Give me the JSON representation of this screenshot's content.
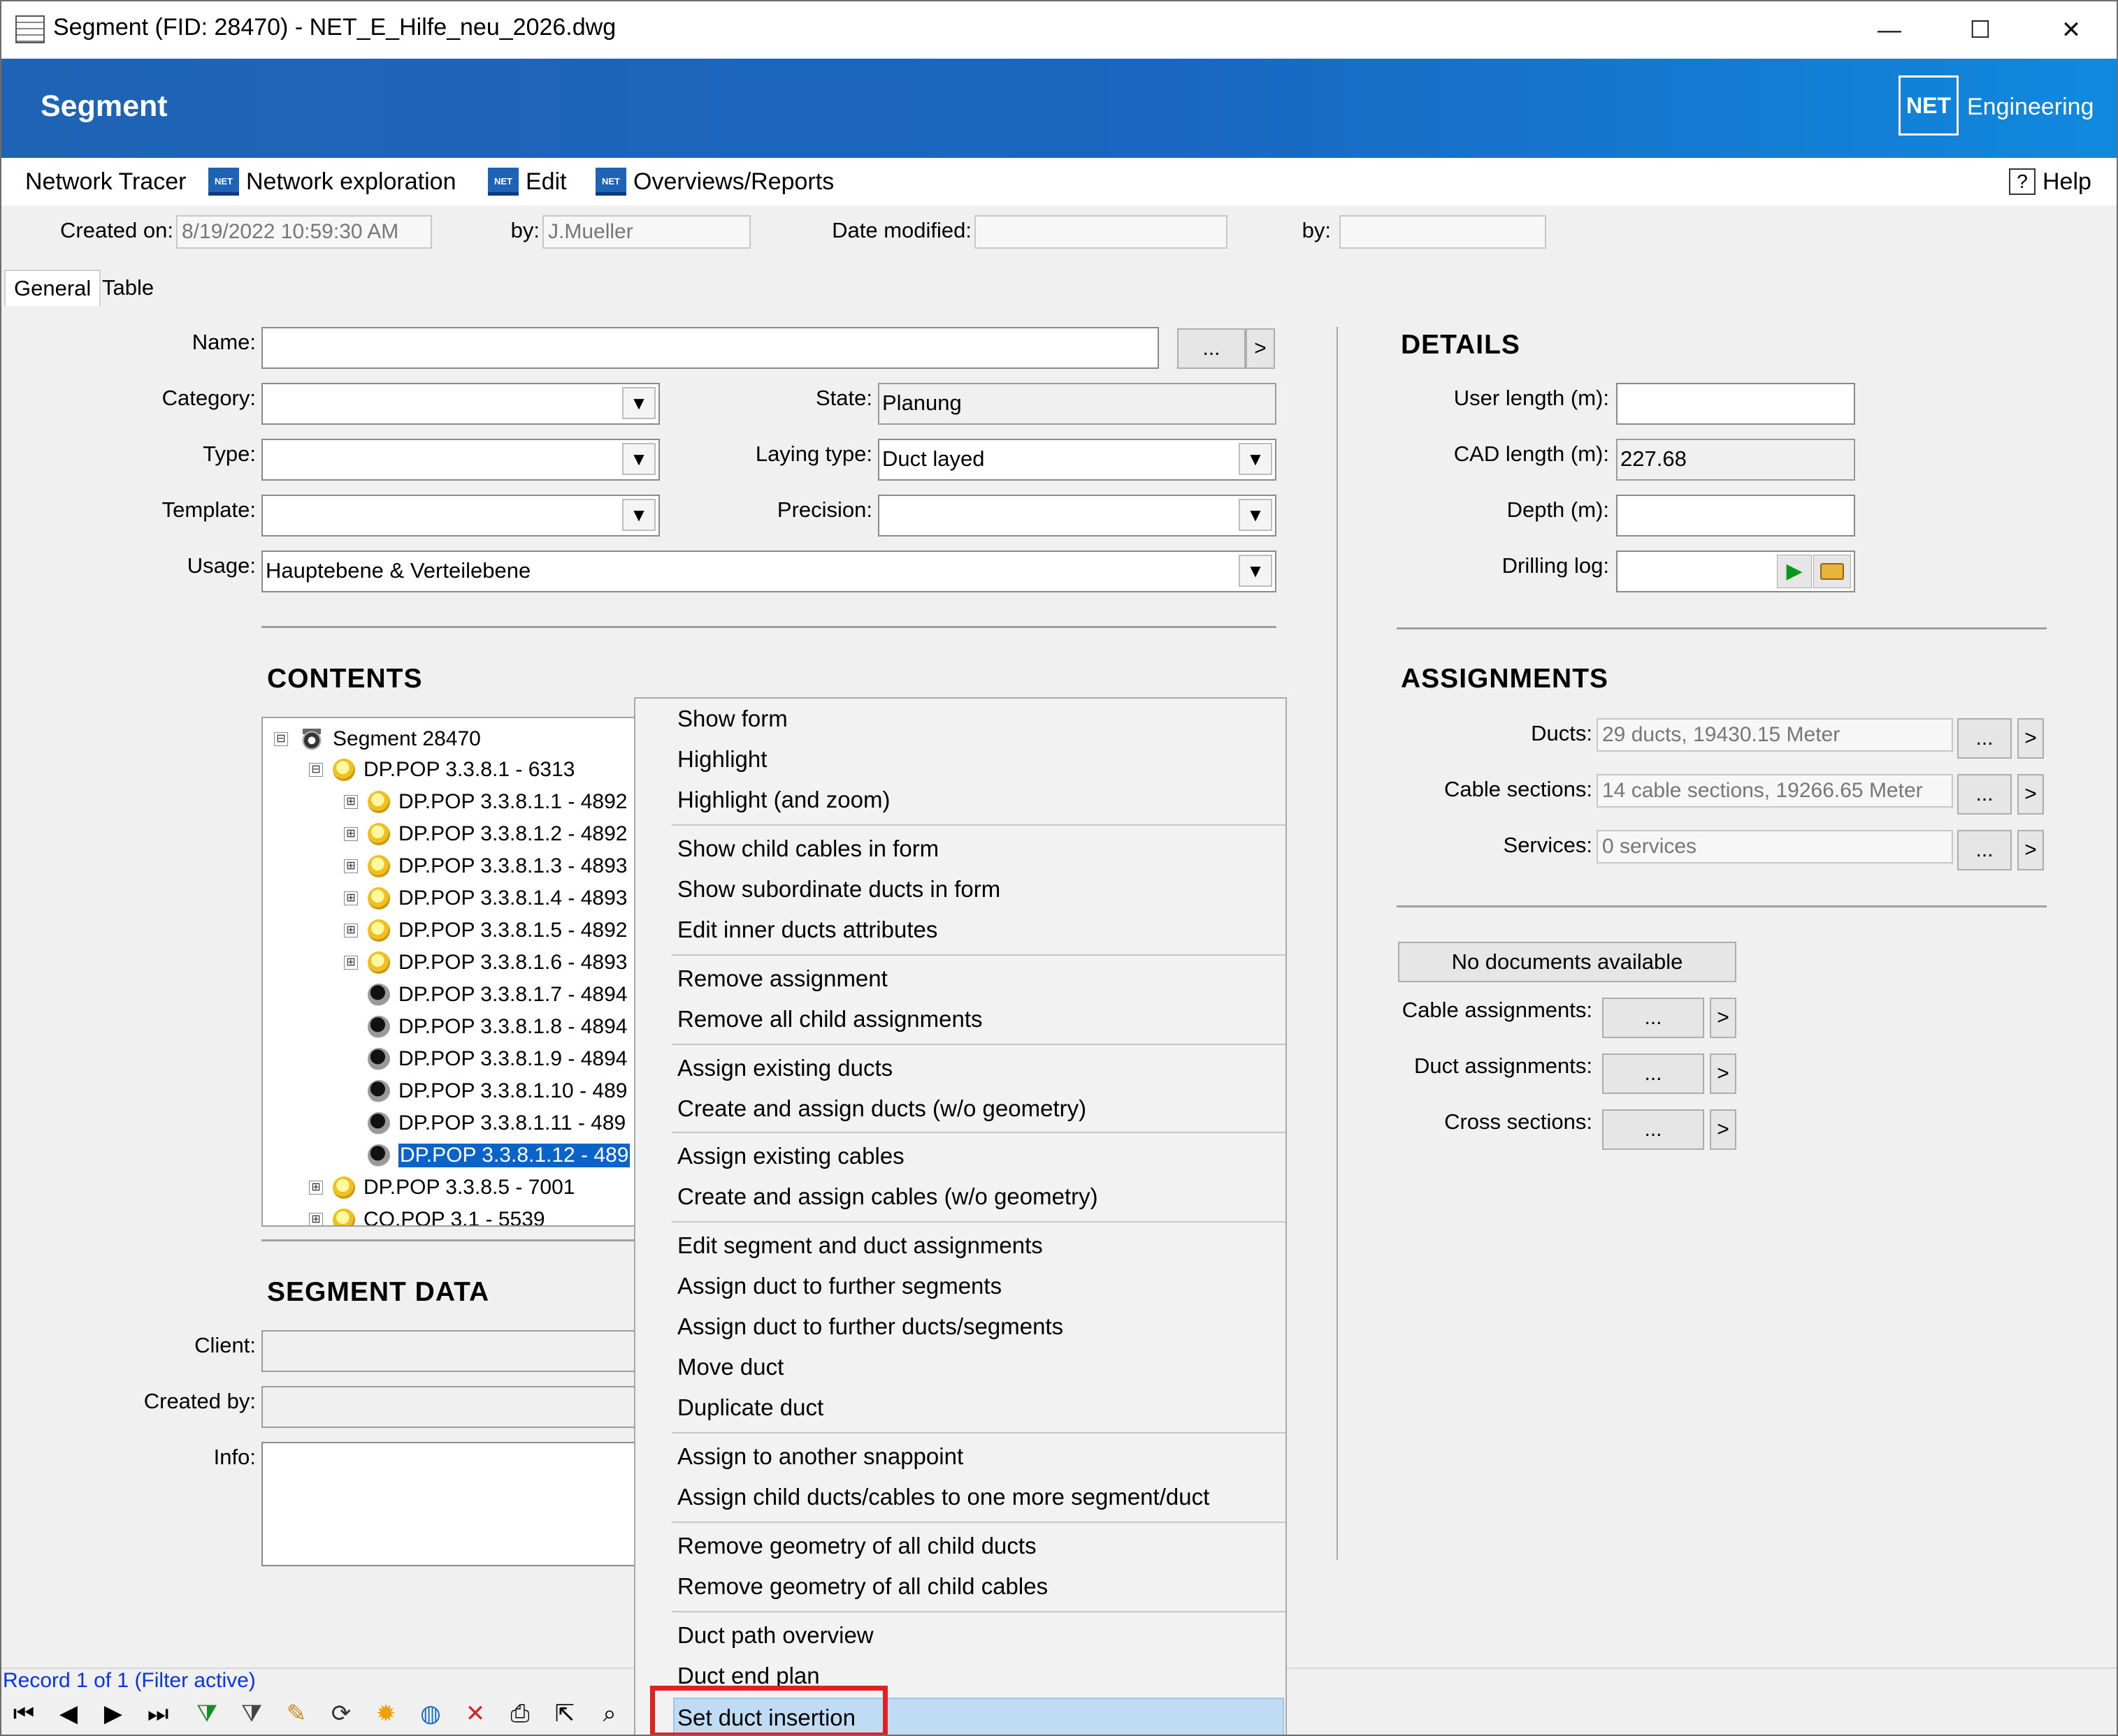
{
  "window": {
    "title": "Segment (FID: 28470) - NET_E_Hilfe_neu_2026.dwg",
    "minimize": "—",
    "maximize": "☐",
    "close": "✕"
  },
  "banner": {
    "title": "Segment",
    "logo": "NET",
    "brand": "Engineering",
    "color": "#1a66c0"
  },
  "menu": {
    "items": [
      "Network Tracer",
      "Network exploration",
      "Edit",
      "Overviews/Reports"
    ],
    "help": "Help",
    "net_icon": "NET"
  },
  "meta": {
    "created_on_label": "Created on:",
    "created_on_value": "8/19/2022 10:59:30 AM",
    "by_label": "by:",
    "by_value": "J.Mueller",
    "modified_label": "Date modified:",
    "modified_value": "",
    "by2_label": "by:",
    "by2_value": ""
  },
  "tabs": [
    "General",
    "Table"
  ],
  "general": {
    "name_label": "Name:",
    "name_value": "",
    "name_btn": "...",
    "name_arrow": ">",
    "category_label": "Category:",
    "type_label": "Type:",
    "template_label": "Template:",
    "usage_label": "Usage:",
    "usage_value": "Hauptebene & Verteilebene",
    "state_label": "State:",
    "state_value": "Planung",
    "laying_label": "Laying type:",
    "laying_value": "Duct layed",
    "precision_label": "Precision:",
    "dropdown_arrow": "▼"
  },
  "contents": {
    "heading": "CONTENTS",
    "tree": [
      {
        "label": "Segment 28470",
        "sign": "⊟",
        "icon": "segment-icon"
      },
      {
        "label": "DP.POP 3.3.8.1 - 6313",
        "sign": "⊟",
        "icon": "yellow"
      },
      {
        "label": "DP.POP 3.3.8.1.1 - 4892",
        "sign": "⊞",
        "icon": "yellow"
      },
      {
        "label": "DP.POP 3.3.8.1.2 - 4892",
        "sign": "⊞",
        "icon": "yellow"
      },
      {
        "label": "DP.POP 3.3.8.1.3 - 4893",
        "sign": "⊞",
        "icon": "yellow"
      },
      {
        "label": "DP.POP 3.3.8.1.4 - 4893",
        "sign": "⊞",
        "icon": "yellow"
      },
      {
        "label": "DP.POP 3.3.8.1.5 - 4892",
        "sign": "⊞",
        "icon": "yellow"
      },
      {
        "label": "DP.POP 3.3.8.1.6 - 4893",
        "sign": "⊞",
        "icon": "yellow"
      },
      {
        "label": "DP.POP 3.3.8.1.7 - 4894",
        "sign": "",
        "icon": "dark"
      },
      {
        "label": "DP.POP 3.3.8.1.8 - 4894",
        "sign": "",
        "icon": "dark"
      },
      {
        "label": "DP.POP 3.3.8.1.9 - 4894",
        "sign": "",
        "icon": "dark"
      },
      {
        "label": "DP.POP 3.3.8.1.10 - 489",
        "sign": "",
        "icon": "dark"
      },
      {
        "label": "DP.POP 3.3.8.1.11 - 489",
        "sign": "",
        "icon": "dark"
      },
      {
        "label": "DP.POP 3.3.8.1.12 - 489",
        "sign": "",
        "icon": "dark",
        "selected": true
      },
      {
        "label": "DP.POP 3.3.8.5 - 7001",
        "sign": "⊞",
        "icon": "yellow"
      },
      {
        "label": "CO.POP 3.1 - 5539",
        "sign": "⊞",
        "icon": "yellow"
      }
    ]
  },
  "segment_data": {
    "heading": "SEGMENT DATA",
    "client_label": "Client:",
    "created_by_label": "Created by:",
    "info_label": "Info:"
  },
  "details": {
    "heading": "DETAILS",
    "user_length_label": "User length (m):",
    "user_length_value": "",
    "cad_length_label": "CAD length (m):",
    "cad_length_value": "227.68",
    "depth_label": "Depth (m):",
    "depth_value": "",
    "drilling_log_label": "Drilling log:"
  },
  "assignments": {
    "heading": "ASSIGNMENTS",
    "ducts_label": "Ducts:",
    "ducts_value": "29 ducts, 19430.15 Meter",
    "cables_label": "Cable sections:",
    "cables_value": "14 cable sections, 19266.65 Meter",
    "services_label": "Services:",
    "services_value": "0 services",
    "btn": "...",
    "arrow": ">",
    "no_docs": "No documents available",
    "cable_assign_label": "Cable assignments:",
    "duct_assign_label": "Duct assignments:",
    "cross_label": "Cross sections:"
  },
  "context_menu": {
    "items": [
      "Show form",
      "Highlight",
      "Highlight (and zoom)",
      "Show child cables in form",
      "Show subordinate ducts in form",
      "Edit inner ducts attributes",
      "Remove assignment",
      "Remove all child assignments",
      "Assign existing ducts",
      "Create and assign ducts (w/o geometry)",
      "Assign existing cables",
      "Create and assign cables (w/o geometry)",
      "Edit segment and duct assignments",
      "Assign duct to further segments",
      "Assign duct to further ducts/segments",
      "Move duct",
      "Duplicate duct",
      "Assign to another snappoint",
      "Assign child ducts/cables to one more segment/duct",
      "Remove geometry of all child ducts",
      "Remove geometry of all child cables",
      "Duct path overview",
      "Duct end plan",
      "Set duct insertion"
    ],
    "highlighted": "Set duct insertion",
    "highlight_color": "#bfdcf4",
    "marker_color": "#e32020"
  },
  "status": {
    "record": "Record 1 of 1 (Filter active)",
    "toolbar_icons": [
      "first-record-icon",
      "prev-record-icon",
      "next-record-icon",
      "last-record-icon",
      "filter-add-icon",
      "filter-remove-icon",
      "pencil-icon",
      "refresh-icon",
      "sun-icon",
      "globe-icon",
      "delete-icon",
      "print-icon",
      "cursor-select-icon",
      "zoom-icon"
    ],
    "glyphs": [
      "⏮",
      "◀",
      "▶",
      "⏭",
      "⧩",
      "⧩",
      "✎",
      "⟳",
      "✹",
      "◍",
      "✕",
      "⎙",
      "⇱",
      "⌕"
    ]
  }
}
